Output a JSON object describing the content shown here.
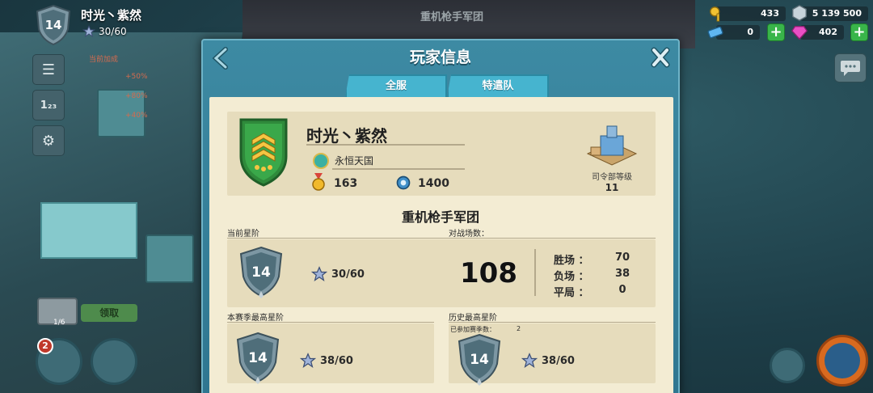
{
  "hud": {
    "player_level": "14",
    "player_name": "时光丶紫然",
    "stars": "30/60",
    "boost_title": "当前加成",
    "boosts": [
      "+50%",
      "+80%",
      "+40%"
    ],
    "chest_count": "1/6",
    "claim_label": "领取",
    "notification_count": "2",
    "background_title": "重机枪手军团"
  },
  "resources": {
    "keys": "433",
    "tokens": "5 139 500",
    "tickets": "0",
    "gems": "402"
  },
  "dialog": {
    "title": "玩家信息",
    "tabs": [
      "全服",
      "特遣队"
    ],
    "player": {
      "name": "时光丶紫然",
      "guild": "永恒天国",
      "medals": "163",
      "intel": "1400"
    },
    "hq": {
      "label": "司令部等级",
      "level": "11"
    },
    "section_title": "重机枪手军团",
    "current": {
      "label": "当前星阶",
      "rank": "14",
      "stars": "30/60",
      "battles_label": "对战场数：",
      "battles": "108",
      "stats": [
        {
          "label": "胜场 ：",
          "value": "70"
        },
        {
          "label": "负场 ：",
          "value": "38"
        },
        {
          "label": "平局 ：",
          "value": "0"
        }
      ]
    },
    "season_best": {
      "label": "本赛季最高星阶",
      "rank": "14",
      "stars": "38/60"
    },
    "history_best": {
      "label": "历史最高星阶",
      "seasons_label": "已参加赛季数：",
      "seasons": "2",
      "rank": "14",
      "stars": "38/60"
    }
  },
  "colors": {
    "dialog_blue": "#3d8aa3",
    "tab_blue": "#46b4cf",
    "panel_cream": "#f3ecd3",
    "card_beige": "#e6dcbc",
    "shield_green": "#3aa84a",
    "rank_steel": "#7d97a3",
    "plus_green": "#39b54a"
  },
  "icons": [
    "back-arrow-icon",
    "close-icon",
    "menu-icon",
    "leaderboard-icon",
    "settings-icon",
    "key-icon",
    "token-icon",
    "ticket-icon",
    "gem-icon",
    "chat-icon",
    "star-icon",
    "medal-icon",
    "gear-icon",
    "guild-icon"
  ]
}
